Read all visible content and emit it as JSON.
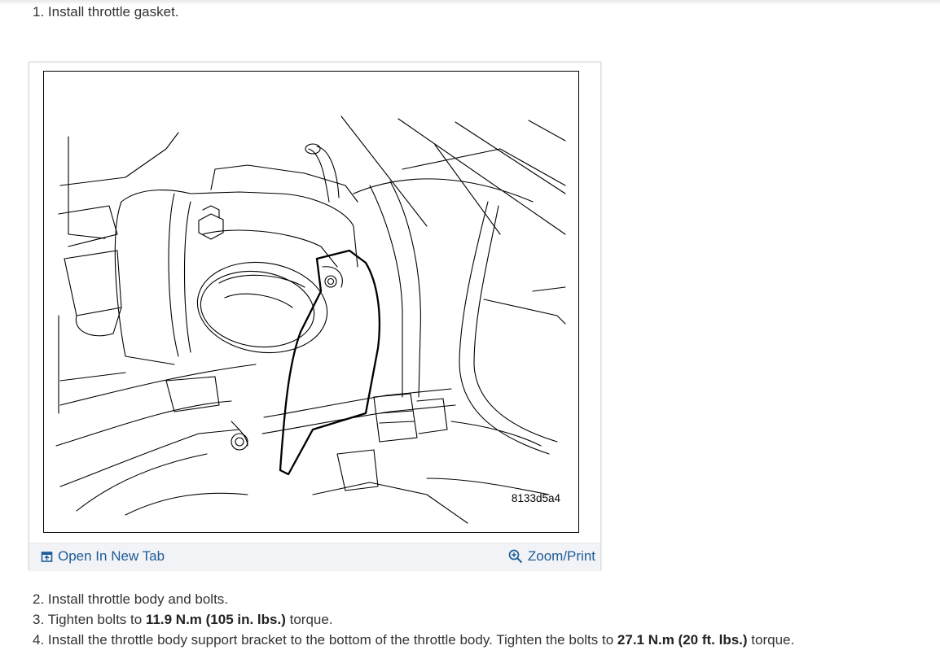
{
  "steps": {
    "step1": "1. Install throttle gasket.",
    "step2": "2. Install throttle body and bolts.",
    "step3_prefix": "3. Tighten bolts to ",
    "step3_value": "11.9 N.m (105 in. lbs.)",
    "step3_suffix": " torque.",
    "step4_prefix": "4. Install the throttle body support bracket to the bottom of the throttle body. Tighten the bolts to ",
    "step4_value": "27.1 N.m (20 ft. lbs.)",
    "step4_suffix": " torque."
  },
  "figure": {
    "id_label": "8133d5a4",
    "open_tab_label": "Open In New Tab",
    "zoom_label": "Zoom/Print"
  },
  "icons": {
    "open_tab": "open-external-icon",
    "zoom": "zoom-in-icon"
  },
  "colors": {
    "link": "#1f5b96",
    "text": "#333333"
  }
}
